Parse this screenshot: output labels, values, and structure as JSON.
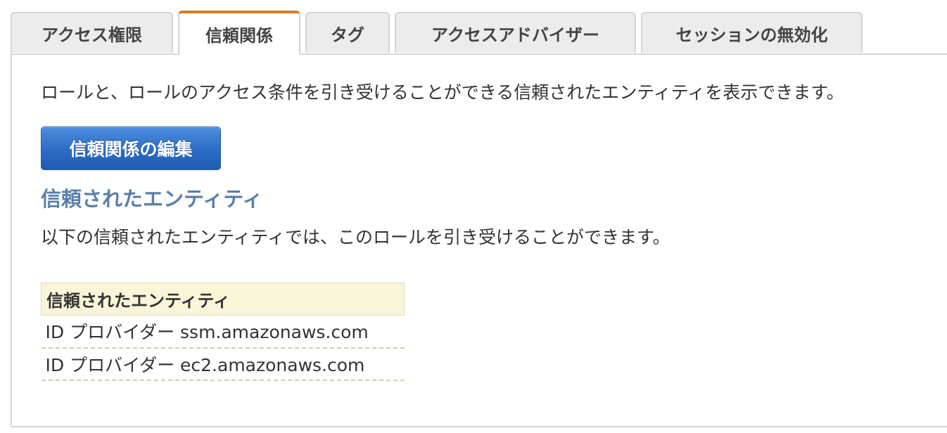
{
  "tabs": [
    {
      "label": "アクセス権限",
      "active": false
    },
    {
      "label": "信頼関係",
      "active": true
    },
    {
      "label": "タグ",
      "active": false
    },
    {
      "label": "アクセスアドバイザー",
      "active": false
    },
    {
      "label": "セッションの無効化",
      "active": false
    }
  ],
  "intro_text": "ロールと、ロールのアクセス条件を引き受けることができる信頼されたエンティティを表示できます。",
  "edit_button_label": "信頼関係の編集",
  "section": {
    "heading": "信頼されたエンティティ",
    "description": "以下の信頼されたエンティティでは、このロールを引き受けることができます。"
  },
  "entities_table": {
    "header": "信頼されたエンティティ",
    "rows": [
      "ID プロバイダー ssm.amazonaws.com",
      "ID プロバイダー ec2.amazonaws.com"
    ]
  },
  "colors": {
    "active_tab_accent": "#e07b1a",
    "button_blue": "#2b6cc4",
    "heading_blue": "#5a7fab",
    "table_header_bg": "#f8f5d8"
  }
}
